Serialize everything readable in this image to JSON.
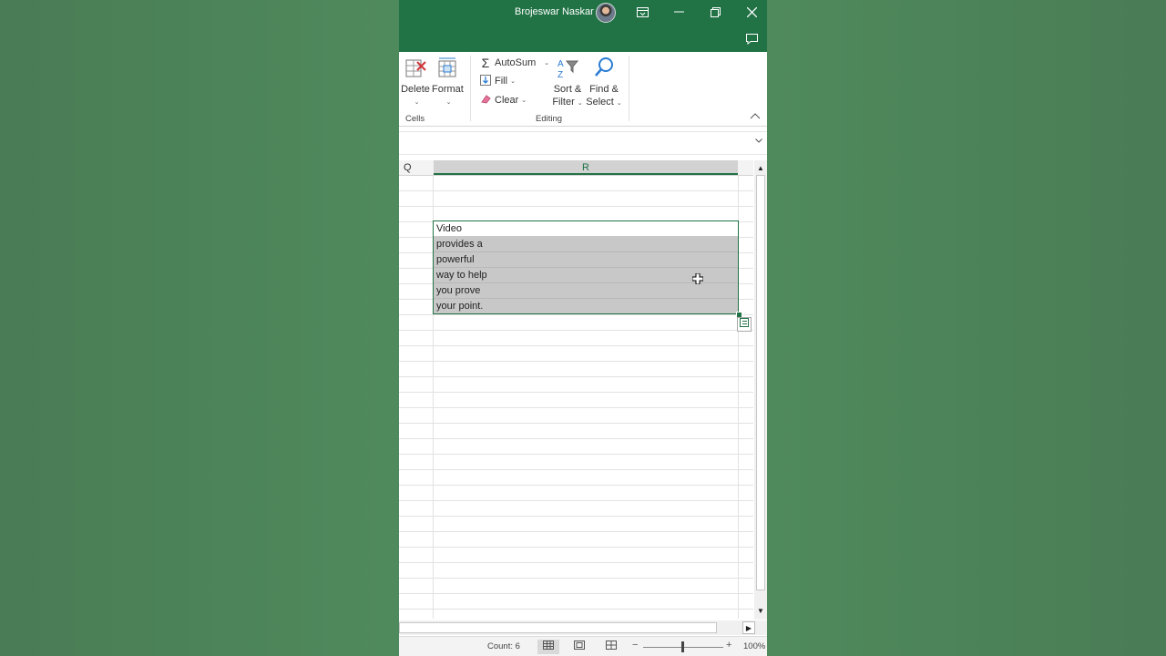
{
  "titlebar": {
    "user_name": "Brojeswar Naskar",
    "icons": [
      "ribbon-display-options-icon",
      "minimize-icon",
      "restore-icon",
      "close-icon",
      "comments-icon"
    ]
  },
  "ribbon": {
    "cells_group": {
      "label": "Cells",
      "delete_label": "Delete",
      "format_label": "Format"
    },
    "editing_group": {
      "label": "Editing",
      "autosum_label": "AutoSum",
      "fill_label": "Fill",
      "clear_label": "Clear",
      "sort_label_1": "Sort &",
      "sort_label_2": "Filter",
      "find_label_1": "Find &",
      "find_label_2": "Select"
    }
  },
  "grid": {
    "columns": [
      "Q",
      "R"
    ],
    "selected_column": "R",
    "cells": [
      {
        "value": "Video"
      },
      {
        "value": "provides a"
      },
      {
        "value": "powerful"
      },
      {
        "value": "way to help"
      },
      {
        "value": "you prove"
      },
      {
        "value": "your point."
      }
    ]
  },
  "statusbar": {
    "count": "Count: 6",
    "zoom": "100%",
    "zoom_level": 100
  },
  "colors": {
    "excel_green": "#217346",
    "selection_fill": "#c8c8c8",
    "background": "#4b7f57"
  }
}
